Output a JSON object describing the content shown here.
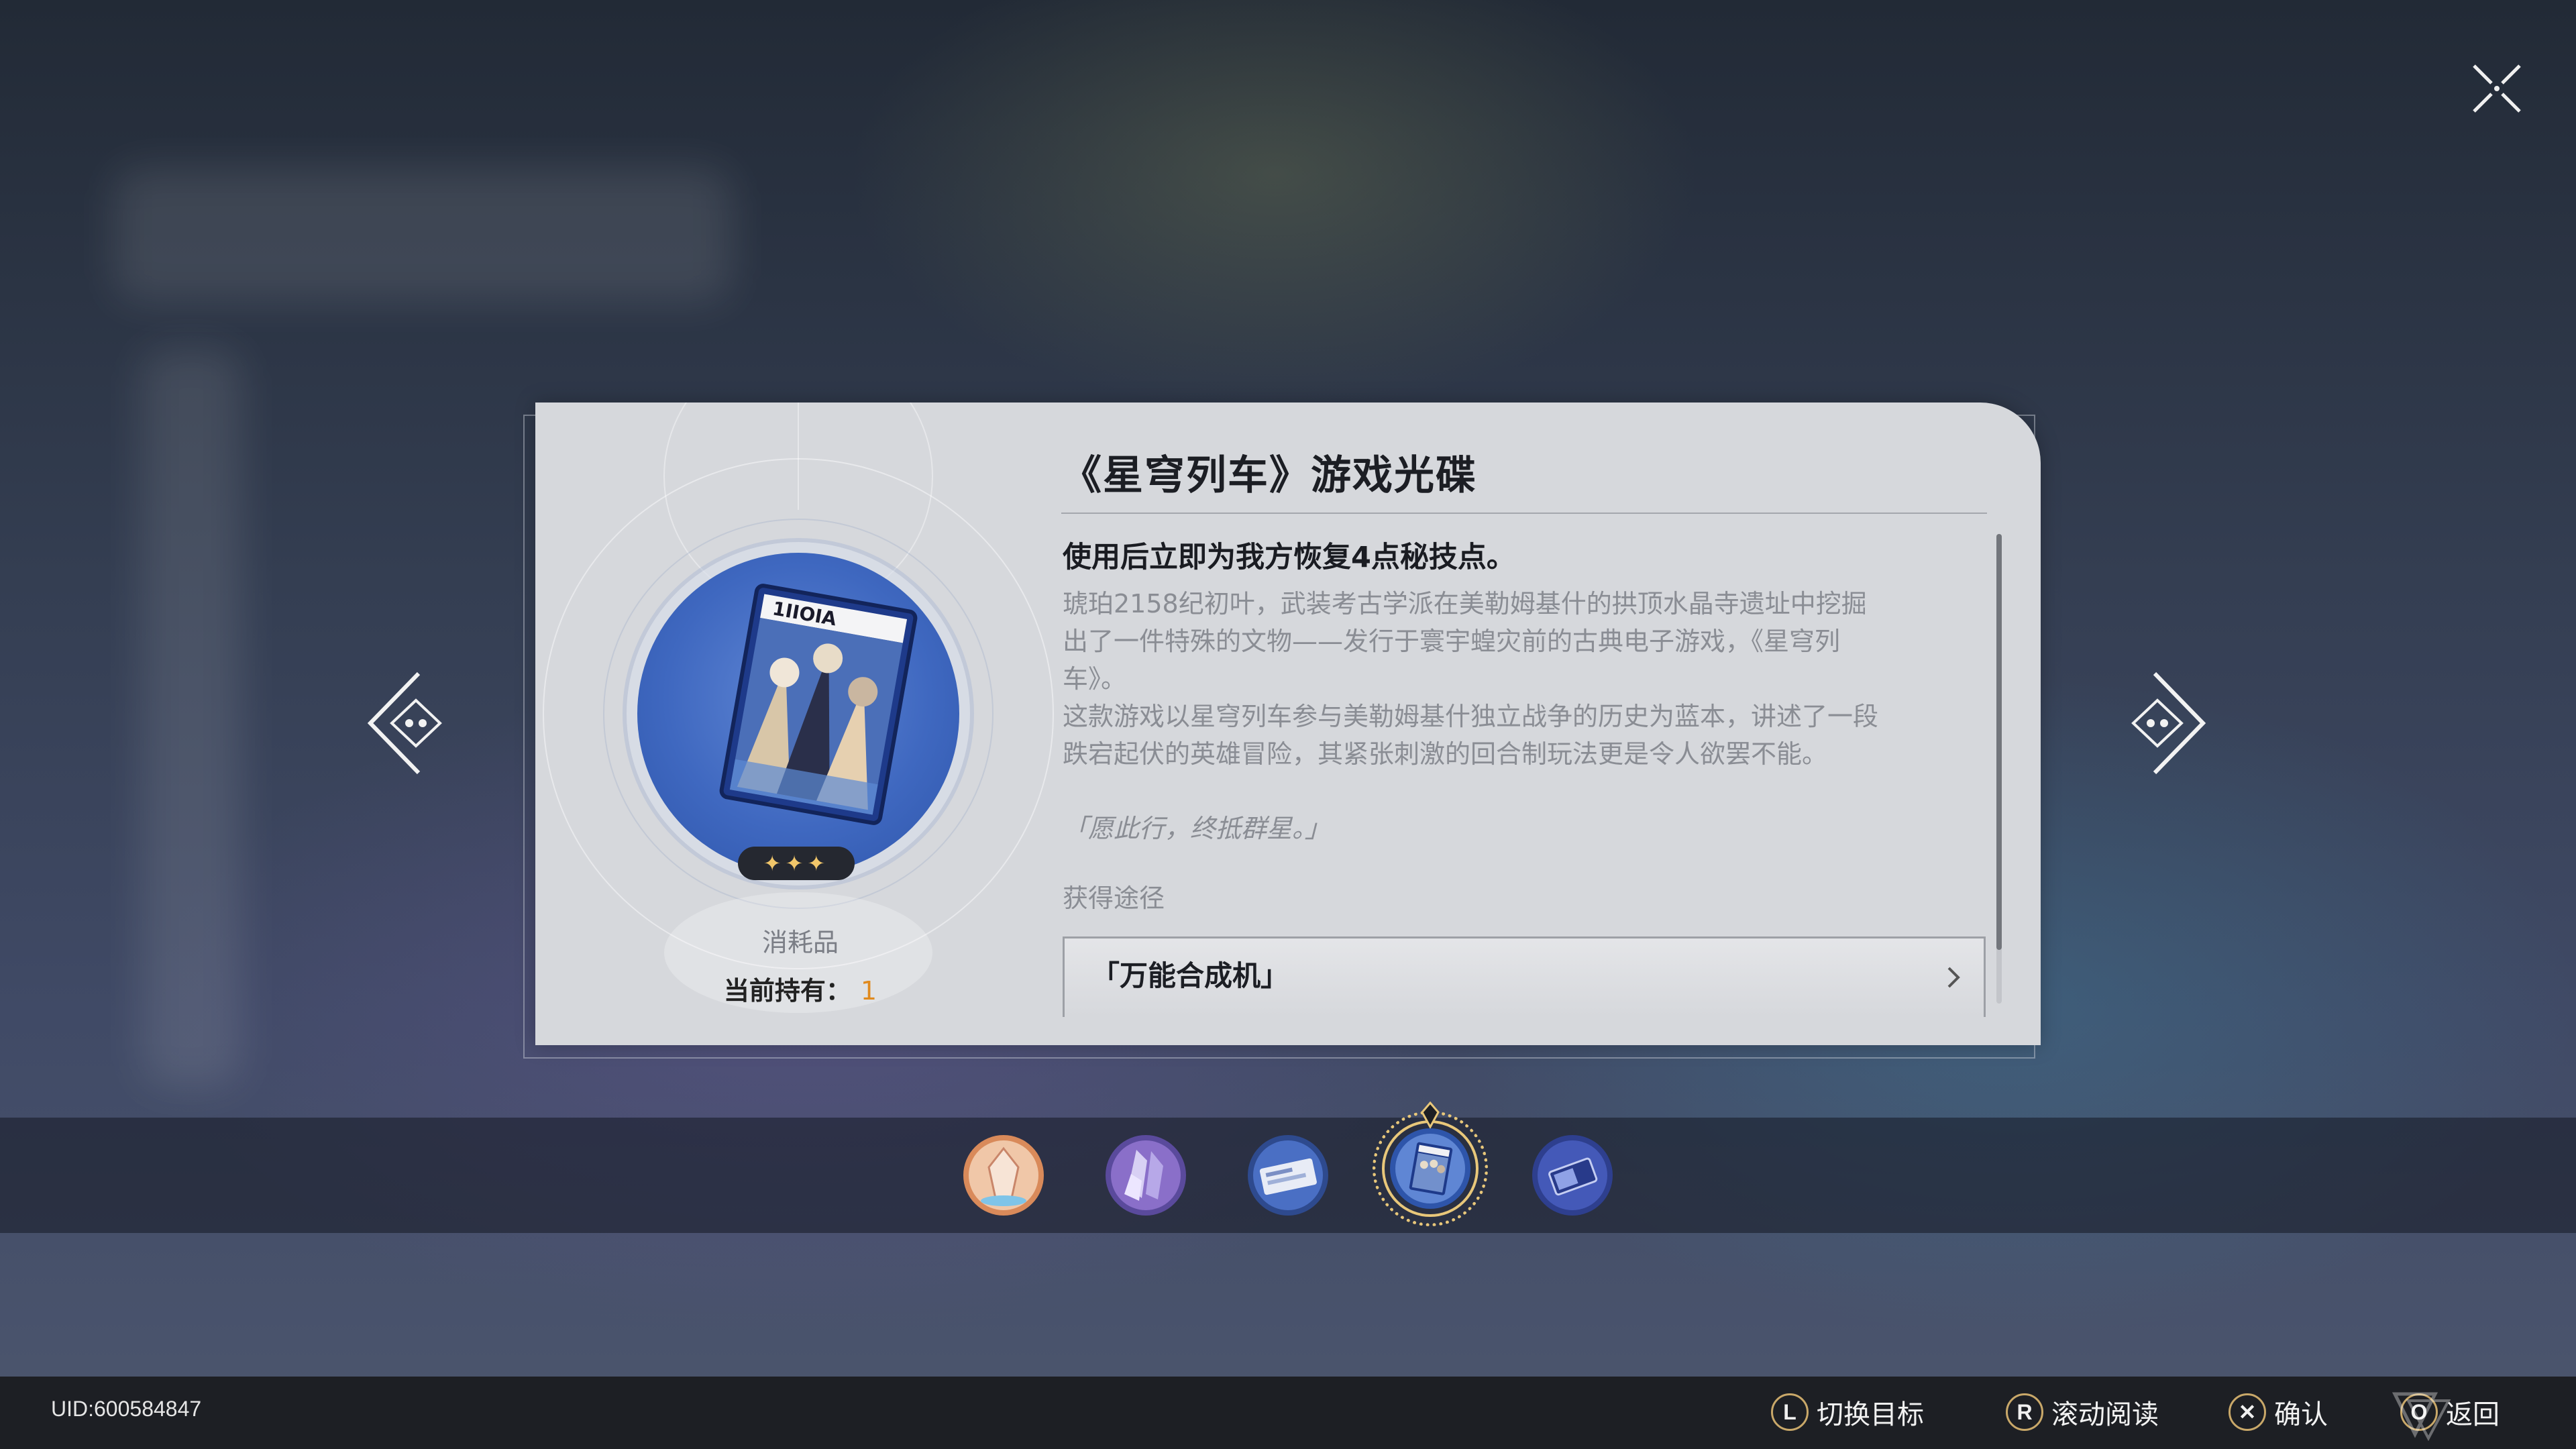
{
  "item": {
    "title": "《星穹列车》游戏光碟",
    "effect": "使用后立即为我方恢复4点秘技点。",
    "description": "琥珀2158纪初叶，武装考古学派在美勒姆基什的拱顶水晶寺遗址中挖掘\n出了一件特殊的文物——发行于寰宇蝗灾前的古典电子游戏，《星穹列\n车》。\n这款游戏以星穹列车参与美勒姆基什独立战争的历史为蓝本，讲述了一段\n跌宕起伏的英雄冒险，其紧张刺激的回合制玩法更是令人欲罢不能。",
    "quote": "「愿此行，终抵群星。」",
    "source_label": "获得途径",
    "source_button": "「万能合成机」",
    "type": "消耗品",
    "owned_label": "当前持有：",
    "owned_count": "1",
    "rarity_stars": "✦✦✦",
    "rarity": 3
  },
  "disc_cover_text": "1ΙΙΟΙΑ",
  "nav": {
    "prev_icon": "chevron-left-icon",
    "next_icon": "chevron-right-icon",
    "close_icon": "close-icon"
  },
  "item_bar": {
    "items": [
      {
        "name": "crystal-item",
        "color": "#d98a5a"
      },
      {
        "name": "crystal-cluster-item",
        "color": "#8a6fc9"
      },
      {
        "name": "ticket-item",
        "color": "#4a6fc4"
      },
      {
        "name": "game-disc-item",
        "color": "#3f68c0",
        "selected": true
      },
      {
        "name": "card-item",
        "color": "#4459b8"
      }
    ]
  },
  "bottom": {
    "uid": "UID:600584847",
    "hints": [
      {
        "key": "L",
        "label": "切换目标"
      },
      {
        "key": "R",
        "label": "滚动阅读"
      },
      {
        "key": "✕",
        "label": "确认"
      },
      {
        "key": "O",
        "label": "返回"
      }
    ]
  },
  "colors": {
    "accent_gold": "#e8c77a",
    "owned_count": "#e08a1e",
    "card_bg": "#d6d8dc"
  }
}
